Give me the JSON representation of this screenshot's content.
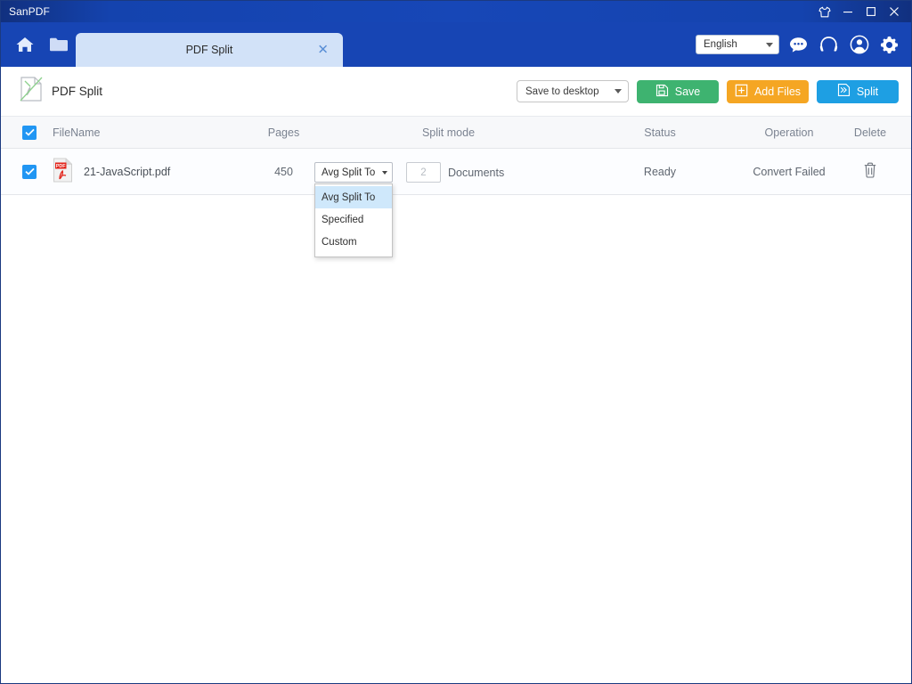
{
  "window": {
    "app_title": "SanPDF",
    "controls": {
      "skin_icon": "tshirt-icon",
      "minimize_icon": "minimize-icon",
      "maximize_icon": "maximize-icon",
      "close_icon": "close-icon"
    }
  },
  "navbar": {
    "home_icon": "home-icon",
    "folder_icon": "folder-icon",
    "tab": {
      "label": "PDF Split",
      "close_icon": "close-icon"
    },
    "language": {
      "value": "English",
      "options": [
        "English"
      ],
      "caret_icon": "chevron-down-icon"
    },
    "icons": [
      {
        "name": "chat-icon"
      },
      {
        "name": "headphones-icon"
      },
      {
        "name": "user-account-icon"
      },
      {
        "name": "gear-icon"
      }
    ]
  },
  "toolbar": {
    "mode_icon": "pdf-split-icon",
    "mode_title": "PDF Split",
    "save_path": {
      "value": "Save to desktop",
      "caret_icon": "chevron-down-icon"
    },
    "save_button": {
      "label": "Save",
      "icon": "floppy-save-icon",
      "color": "#3eb370"
    },
    "add_files_button": {
      "label": "Add Files",
      "icon": "plus-square-icon",
      "color": "#f5a623"
    },
    "split_button": {
      "label": "Split",
      "icon": "split-arrows-icon",
      "color": "#1e9fe3"
    }
  },
  "table": {
    "select_all_checked": true,
    "headers": {
      "filename": "FileName",
      "pages": "Pages",
      "split_mode": "Split mode",
      "status": "Status",
      "operation": "Operation",
      "delete": "Delete"
    },
    "rows": [
      {
        "checked": true,
        "file_icon": "pdf-file-icon",
        "filename": "21-JavaScript.pdf",
        "pages": "450",
        "split_mode_value": "Avg Split To",
        "doc_count_value": "2",
        "doc_count_label": "Documents",
        "status": "Ready",
        "operation": "Convert Failed",
        "delete_icon": "trash-icon"
      }
    ]
  },
  "split_mode_dropdown": {
    "open": true,
    "options": [
      {
        "label": "Avg Split To",
        "selected": true
      },
      {
        "label": "Specified",
        "selected": false
      },
      {
        "label": "Custom",
        "selected": false
      }
    ]
  },
  "colors": {
    "titlebar": "#1745b4",
    "tab_active": "#d2e2f8",
    "accent_blue": "#2196f3",
    "save_green": "#3eb370",
    "add_orange": "#f5a623",
    "split_blue": "#1e9fe3",
    "dropdown_highlight": "#cfe8fb"
  }
}
